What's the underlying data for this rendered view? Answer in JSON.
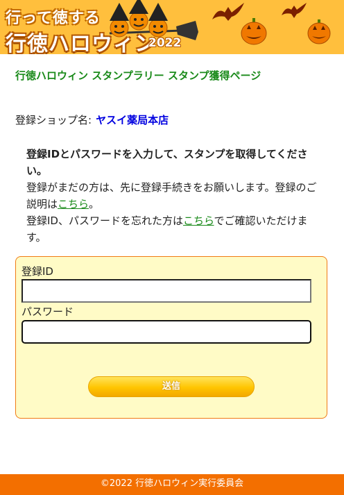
{
  "header": {
    "logo_top": "行って徳する",
    "logo_main": "行徳ハロウィン",
    "logo_year": "2022"
  },
  "page_title": "行徳ハロウィン スタンプラリー スタンプ獲得ページ",
  "shop": {
    "label": "登録ショップ名:",
    "name": "ヤスイ薬局本店"
  },
  "instructions": {
    "lead": "登録IDとパスワードを入力して、スタンプを取得してください。",
    "line2_prefix": "登録がまだの方は、先に登録手続きをお願いします。登録のご説明は",
    "link1": "こちら",
    "line2_suffix": "。",
    "line3_prefix": "登録ID、パスワードを忘れた方は",
    "link2": "こちら",
    "line3_suffix": "でご確認いただけます。"
  },
  "form": {
    "id_label": "登録ID",
    "id_value": "",
    "password_label": "パスワード",
    "password_value": "",
    "submit_label": "送信"
  },
  "footer": {
    "copyright": "©2022 行徳ハロウィン実行委員会"
  },
  "colors": {
    "header_bg": "#ffbf3d",
    "title_green": "#1a8a1a",
    "shop_blue": "#0000e0",
    "form_bg": "#fffbc6",
    "form_border": "#f07a14",
    "footer_bg": "#f36f00"
  }
}
